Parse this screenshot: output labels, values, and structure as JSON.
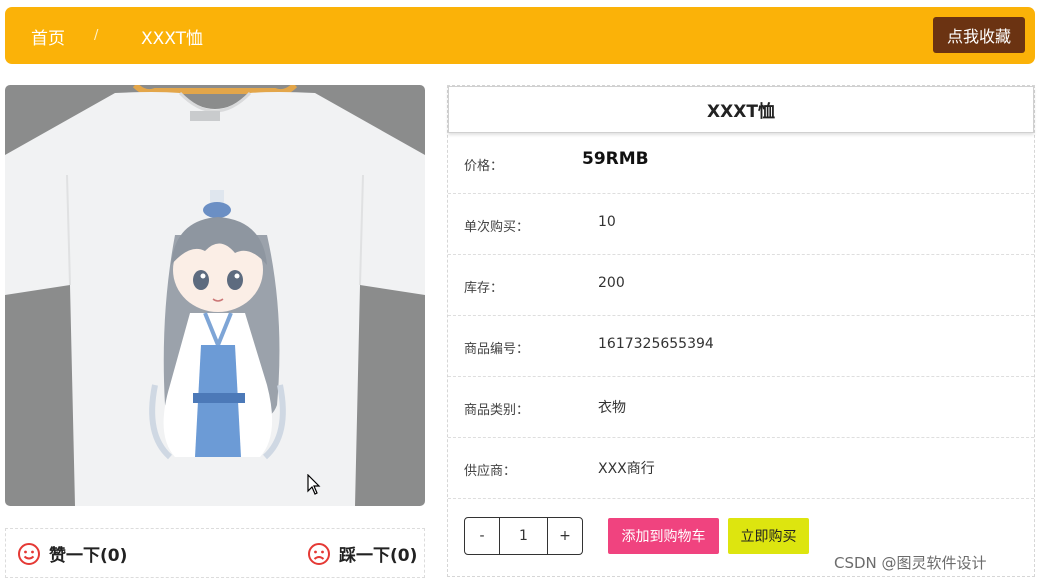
{
  "breadcrumb": {
    "home": "首页",
    "separator": "/",
    "current": "XXXT恤"
  },
  "header": {
    "favorite_label": "点我收藏",
    "bar_color": "#fbb208",
    "favorite_color": "#6b3312"
  },
  "product": {
    "title": "XXXT恤",
    "image_icon": "white-tshirt-chibi-character-image"
  },
  "details": [
    {
      "label": "价格：",
      "value": "59RMB"
    },
    {
      "label": "单次购买：",
      "value": "10"
    },
    {
      "label": "库存：",
      "value": "200"
    },
    {
      "label": "商品编号：",
      "value": "1617325655394"
    },
    {
      "label": "商品类别：",
      "value": "衣物"
    },
    {
      "label": "供应商：",
      "value": "XXX商行"
    }
  ],
  "purchase": {
    "minus": "-",
    "quantity": "1",
    "plus": "+",
    "add_to_cart": "添加到购物车",
    "buy_now": "立即购买",
    "cart_color": "#f0437f",
    "buy_color": "#dde50f"
  },
  "votes": {
    "like": "赞一下(0)",
    "dislike": "踩一下(0)",
    "like_icon": "smile-icon",
    "dislike_icon": "frown-icon",
    "icon_color": "#e53935"
  },
  "watermark": "CSDN @图灵软件设计"
}
